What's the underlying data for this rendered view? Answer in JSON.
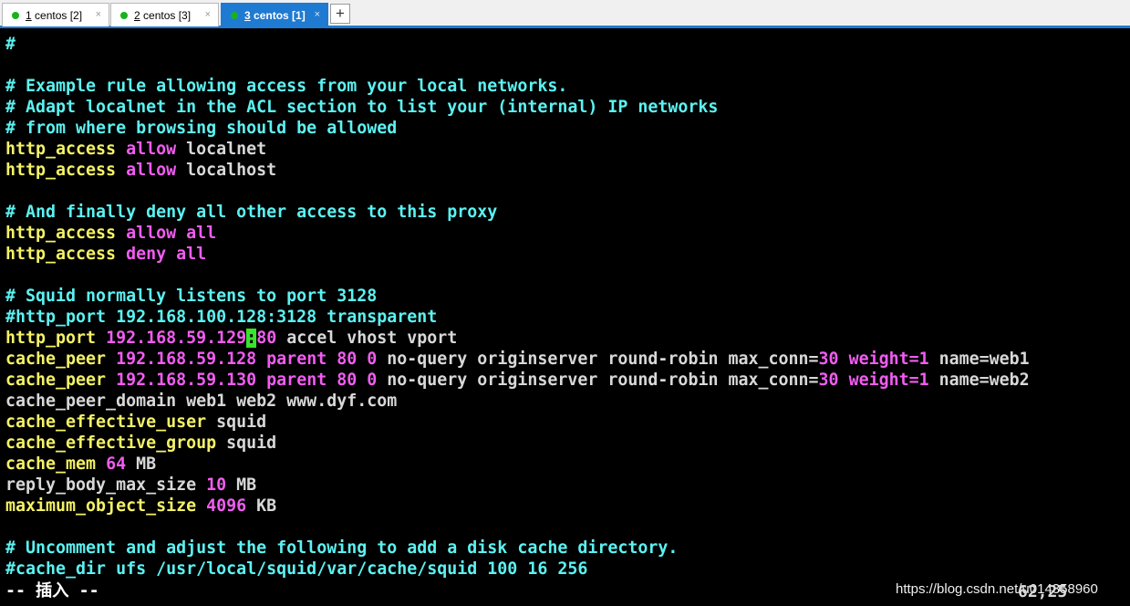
{
  "tabs": [
    {
      "number": "1",
      "label": " centos [2]",
      "close": "×",
      "status_color": "#17b21e"
    },
    {
      "number": "2",
      "label": " centos [3]",
      "close": "×",
      "status_color": "#17b21e"
    },
    {
      "number": "3",
      "label": " centos [1]",
      "close": "×",
      "status_color": "#17b21e",
      "active": true
    }
  ],
  "new_tab_label": "+",
  "accent_color": "#1f7ad1",
  "editor": {
    "lines": [
      [
        {
          "t": "#",
          "c": "comment"
        }
      ],
      [],
      [
        {
          "t": "# Example rule allowing access from your local networks.",
          "c": "comment"
        }
      ],
      [
        {
          "t": "# Adapt localnet in the ACL section to list your (internal) IP networks",
          "c": "comment"
        }
      ],
      [
        {
          "t": "# from where browsing should be allowed",
          "c": "comment"
        }
      ],
      [
        {
          "t": "http_access",
          "c": "key"
        },
        {
          "t": " ",
          "c": "plain"
        },
        {
          "t": "allow",
          "c": "kw"
        },
        {
          "t": " localnet",
          "c": "plain"
        }
      ],
      [
        {
          "t": "http_access",
          "c": "key"
        },
        {
          "t": " ",
          "c": "plain"
        },
        {
          "t": "allow",
          "c": "kw"
        },
        {
          "t": " localhost",
          "c": "plain"
        }
      ],
      [],
      [
        {
          "t": "# And finally deny all other access to this proxy",
          "c": "comment"
        }
      ],
      [
        {
          "t": "http_access",
          "c": "key"
        },
        {
          "t": " ",
          "c": "plain"
        },
        {
          "t": "allow all",
          "c": "kw"
        }
      ],
      [
        {
          "t": "http_access",
          "c": "key"
        },
        {
          "t": " ",
          "c": "plain"
        },
        {
          "t": "deny all",
          "c": "kw"
        }
      ],
      [],
      [
        {
          "t": "# Squid normally listens to port 3128",
          "c": "comment"
        }
      ],
      [
        {
          "t": "#http_port 192.168.100.128:3128 transparent",
          "c": "comment"
        }
      ],
      [
        {
          "t": "http_port",
          "c": "key"
        },
        {
          "t": " ",
          "c": "plain"
        },
        {
          "t": "192.168.59.129",
          "c": "kw"
        },
        {
          "t": ":",
          "c": "cursor"
        },
        {
          "t": "80",
          "c": "kw"
        },
        {
          "t": " accel vhost vport",
          "c": "plain"
        }
      ],
      [
        {
          "t": "cache_peer",
          "c": "key"
        },
        {
          "t": " ",
          "c": "plain"
        },
        {
          "t": "192.168.59.128 parent 80 0",
          "c": "kw"
        },
        {
          "t": " no-query originserver round-robin max_conn=",
          "c": "plain"
        },
        {
          "t": "30",
          "c": "kw"
        },
        {
          "t": " ",
          "c": "plain"
        },
        {
          "t": "weight=1",
          "c": "kw"
        },
        {
          "t": " name=web1",
          "c": "plain"
        }
      ],
      [
        {
          "t": "cache_peer",
          "c": "key"
        },
        {
          "t": " ",
          "c": "plain"
        },
        {
          "t": "192.168.59.130 parent 80 0",
          "c": "kw"
        },
        {
          "t": " no-query originserver round-robin max_conn=",
          "c": "plain"
        },
        {
          "t": "30",
          "c": "kw"
        },
        {
          "t": " ",
          "c": "plain"
        },
        {
          "t": "weight=1",
          "c": "kw"
        },
        {
          "t": " name=web2",
          "c": "plain"
        }
      ],
      [
        {
          "t": "cache_peer_domain web1 web2 www.dyf.com",
          "c": "plain"
        }
      ],
      [
        {
          "t": "cache_effective_user",
          "c": "key"
        },
        {
          "t": " squid",
          "c": "plain"
        }
      ],
      [
        {
          "t": "cache_effective_group",
          "c": "key"
        },
        {
          "t": " squid",
          "c": "plain"
        }
      ],
      [
        {
          "t": "cache_mem",
          "c": "key"
        },
        {
          "t": " ",
          "c": "plain"
        },
        {
          "t": "64",
          "c": "kw"
        },
        {
          "t": " MB",
          "c": "plain"
        }
      ],
      [
        {
          "t": "reply_body_max_size ",
          "c": "plain"
        },
        {
          "t": "10",
          "c": "kw"
        },
        {
          "t": " MB",
          "c": "plain"
        }
      ],
      [
        {
          "t": "maximum_object_size",
          "c": "key"
        },
        {
          "t": " ",
          "c": "plain"
        },
        {
          "t": "4096",
          "c": "kw"
        },
        {
          "t": " KB",
          "c": "plain"
        }
      ],
      [],
      [
        {
          "t": "# Uncomment and adjust the following to add a disk cache directory.",
          "c": "comment"
        }
      ],
      [
        {
          "t": "#cache_dir ufs /usr/local/squid/var/cache/squid 100 16 256",
          "c": "comment"
        }
      ]
    ],
    "mode": "-- 插入 --",
    "cursor_position": "62,25"
  },
  "watermark": "https://blog.csdn.net/u014358960"
}
